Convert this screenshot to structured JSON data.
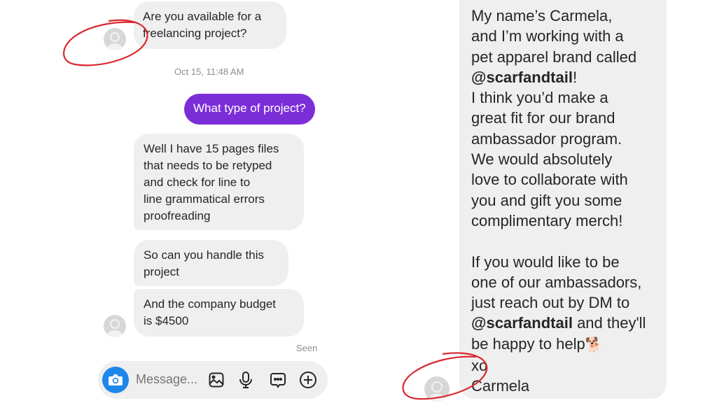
{
  "left_chat": {
    "messages": [
      {
        "from": "them",
        "text": "Are you available for a\nfreelancing project?"
      },
      {
        "from": "me",
        "text": "What type of project?"
      },
      {
        "from": "them",
        "text": "Well I have 15 pages files\nthat needs to be retyped\nand check for line to\nline grammatical errors\nproofreading"
      },
      {
        "from": "them",
        "text": "So can you handle this\nproject"
      },
      {
        "from": "them",
        "text": "And the company budget\nis $4500"
      }
    ],
    "timestamp": "Oct 15, 11:48 AM",
    "seen_label": "Seen",
    "composer": {
      "placeholder": "Message...",
      "icons": [
        "camera-icon",
        "image-icon",
        "microphone-icon",
        "chat-bubble-icon",
        "plus-circle-icon"
      ]
    },
    "colors": {
      "sent_bubble": "#7b2ed8",
      "camera_button": "#1d87ea",
      "received_bubble": "#efefef"
    }
  },
  "right_chat": {
    "lines_part1": [
      "My name’s Carmela,",
      "and I’m working with a",
      "pet apparel brand called"
    ],
    "handle": "@scarfandtail",
    "handle_suffix_1": "!",
    "lines_part2": [
      "I think you’d make a",
      "great fit for our brand",
      "ambassador program.",
      "We would absolutely",
      "love to collaborate with",
      "you and gift you some",
      "complimentary merch!"
    ],
    "lines_part3": [
      "If you would like to be",
      "one of our ambassadors,",
      "just reach out by DM to"
    ],
    "handle_suffix_2": " and they'll",
    "line_help": "be happy to help",
    "emoji": "🐕",
    "signoff": "xo",
    "signature": "Carmela"
  },
  "annotations": {
    "circle_color": "#d9282f"
  }
}
